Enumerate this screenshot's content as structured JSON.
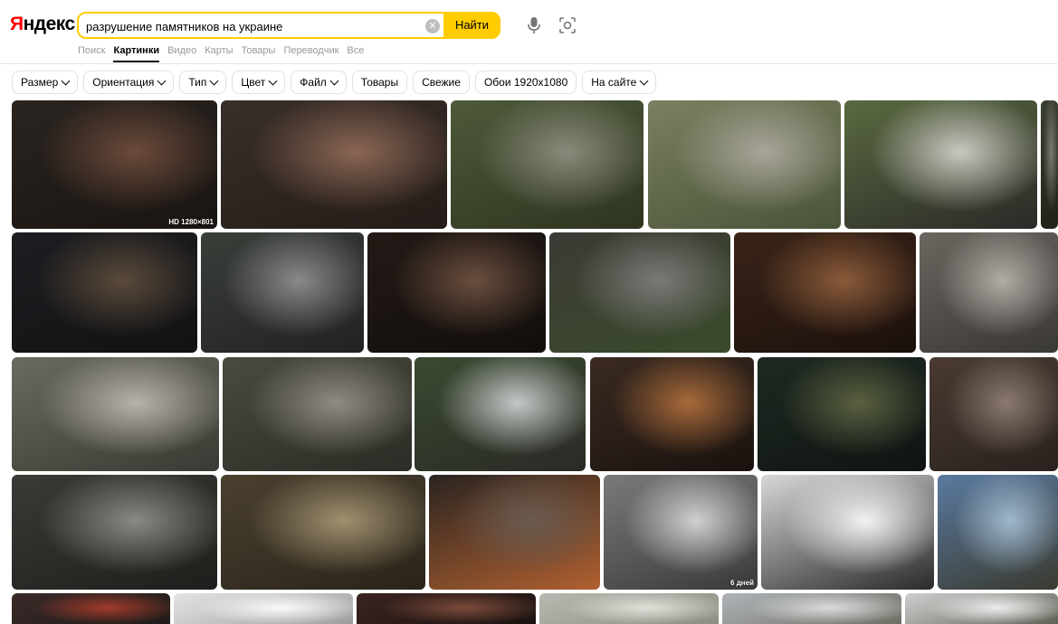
{
  "logo": {
    "ya": "Я",
    "rest": "ндекс"
  },
  "search": {
    "query": "разрушение памятников на украине",
    "button_label": "Найти",
    "clear_icon": "close-icon"
  },
  "services": [
    "Поиск",
    "Картинки",
    "Видео",
    "Карты",
    "Товары",
    "Переводчик",
    "Все"
  ],
  "active_service": "Картинки",
  "filters": [
    {
      "label": "Размер",
      "dropdown": true
    },
    {
      "label": "Ориентация",
      "dropdown": true
    },
    {
      "label": "Тип",
      "dropdown": true
    },
    {
      "label": "Цвет",
      "dropdown": true
    },
    {
      "label": "Файл",
      "dropdown": true
    },
    {
      "label": "Товары",
      "dropdown": false
    },
    {
      "label": "Свежие",
      "dropdown": false
    },
    {
      "label": "Обои 1920x1080",
      "dropdown": false
    },
    {
      "label": "На сайте",
      "dropdown": true
    }
  ],
  "results": [
    {
      "badge": "HD 1280×801",
      "colors": [
        "#2a2420",
        "#6b4a3a",
        "#1a1512"
      ]
    },
    {
      "badge": "",
      "colors": [
        "#3a2f2a",
        "#8a6654",
        "#241c18"
      ]
    },
    {
      "badge": "",
      "colors": [
        "#4e5a3a",
        "#8a8a7a",
        "#2e3420"
      ]
    },
    {
      "badge": "",
      "colors": [
        "#7a8060",
        "#a9a59a",
        "#4a5438"
      ]
    },
    {
      "badge": "",
      "colors": [
        "#5a6a40",
        "#c9c8c0",
        "#2a2a28"
      ]
    },
    {
      "badge": "",
      "colors": [
        "#3a4030",
        "#7a7a70",
        "#20221a"
      ]
    },
    {
      "badge": "",
      "colors": [
        "#1e1e22",
        "#5a4a3a",
        "#121214"
      ]
    },
    {
      "badge": "",
      "colors": [
        "#3a3f3a",
        "#8a8a88",
        "#222"
      ]
    },
    {
      "badge": "",
      "colors": [
        "#231a16",
        "#6a4e3e",
        "#120e0c"
      ]
    },
    {
      "badge": "",
      "colors": [
        "#3c3a36",
        "#7a7a78",
        "#3a4a2a"
      ]
    },
    {
      "badge": "",
      "colors": [
        "#3a2418",
        "#8a5a3a",
        "#1a100c"
      ]
    },
    {
      "badge": "",
      "colors": [
        "#6a6660",
        "#b0aca6",
        "#3a3834"
      ]
    },
    {
      "badge": "",
      "colors": [
        "#6a6a60",
        "#b7b3ab",
        "#3a3a34"
      ]
    },
    {
      "badge": "",
      "colors": [
        "#4a4a40",
        "#8f8c82",
        "#2c2c26"
      ]
    },
    {
      "badge": "",
      "colors": [
        "#3a4a30",
        "#c4c8c8",
        "#2a2a26"
      ]
    },
    {
      "badge": "",
      "colors": [
        "#3a2a22",
        "#a86a3a",
        "#1a120e"
      ]
    },
    {
      "badge": "",
      "colors": [
        "#1e2a22",
        "#5a6040",
        "#101412"
      ]
    },
    {
      "badge": "",
      "colors": [
        "#4a3a32",
        "#8a7a70",
        "#2a221e"
      ]
    },
    {
      "badge": "",
      "colors": [
        "#3a3a36",
        "#8a8a84",
        "#1e1e1c"
      ]
    },
    {
      "badge": "",
      "colors": [
        "#4a4030",
        "#a09070",
        "#2a2418"
      ]
    },
    {
      "badge": "",
      "colors": [
        "#2a2420",
        "#6a5a50",
        "#b06030"
      ]
    },
    {
      "badge": "6 дней",
      "colors": [
        "#7a7a7a",
        "#d0d0d0",
        "#3a3a3a"
      ]
    },
    {
      "badge": "",
      "colors": [
        "#d8d8d8",
        "#f2f2f2",
        "#2a2a2a"
      ]
    },
    {
      "badge": "",
      "colors": [
        "#5a7aa0",
        "#a0b8cc",
        "#3a3a30"
      ]
    },
    {
      "badge": "",
      "colors": [
        "#3a2a28",
        "#a03a2a",
        "#1e1a18"
      ]
    },
    {
      "badge": "",
      "colors": [
        "#e4e4e4",
        "#fafafa",
        "#9a9a9a"
      ]
    },
    {
      "badge": "",
      "colors": [
        "#3a2420",
        "#7a4a3a",
        "#1a1210"
      ]
    },
    {
      "badge": "",
      "colors": [
        "#b8b8b0",
        "#e0e0da",
        "#8a8a80"
      ]
    },
    {
      "badge": "",
      "colors": [
        "#b0b4b8",
        "#dadcdc",
        "#6a6a60"
      ]
    },
    {
      "badge": "",
      "colors": [
        "#d0d0d0",
        "#ececec",
        "#5a5a50"
      ]
    }
  ]
}
